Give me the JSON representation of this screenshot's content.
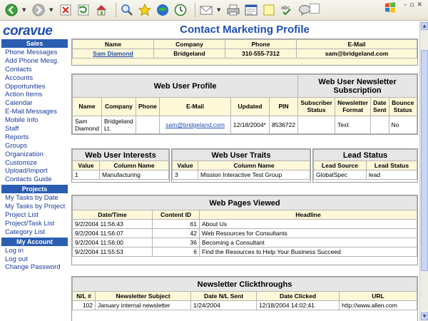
{
  "browser": {
    "icons": [
      "back-icon",
      "forward-icon",
      "stop-icon",
      "refresh-icon",
      "home-icon",
      "search-icon",
      "favorites-icon",
      "media-icon",
      "history-icon",
      "mail-icon",
      "print-icon",
      "edit-icon",
      "discuss-icon",
      "spellcheck-icon",
      "messenger-icon"
    ]
  },
  "brand": {
    "logo_text": "coravue"
  },
  "sidebar": {
    "sales_header": "Sales",
    "sales_items": [
      "Phone Messages",
      "Add Phone Mesg.",
      "Contacts",
      "Accounts",
      "Opportunities",
      "Action Items",
      "Calendar",
      "E-Mail Messages",
      "Mobile Info",
      "Staff",
      "Reports",
      "Groups",
      "Organization",
      "Customize",
      "Upload/Import",
      "Contacts Guide"
    ],
    "projects_header": "Projects",
    "projects_items": [
      "My Tasks by Date",
      "My Tasks by Project",
      "Project List",
      "Project/Task List",
      "Category List"
    ],
    "account_header": "My Account",
    "account_items": [
      "Log in",
      "Log out",
      "Change Password"
    ]
  },
  "page": {
    "title": "Contact Marketing Profile"
  },
  "contact": {
    "headers": [
      "Name",
      "Company",
      "Phone",
      "E-Mail"
    ],
    "name": "Sam Diamond",
    "company": "Bridgeland",
    "phone": "310-555-7312",
    "email": "sam@bridgeland.com"
  },
  "web_user_profile": {
    "title": "Web User Profile",
    "headers": [
      "Name",
      "Company",
      "Phone",
      "E-Mail",
      "Updated",
      "PIN"
    ],
    "name": "Sam Diamond",
    "company": "Bridgeland Lt.",
    "phone": "",
    "email": "sam@bridgeland.com",
    "updated": "12/18/2004*",
    "pin": "8536722"
  },
  "newsletter_subscription": {
    "title": "Web User Newsletter Subscription",
    "headers": [
      "Subscriber Status",
      "Newsletter Format",
      "Date Sent",
      "Bounce Status"
    ],
    "subscriber_status": "",
    "format": "Text",
    "date_sent": "",
    "bounce_status": "No"
  },
  "interests": {
    "title": "Web User Interests",
    "headers": [
      "Value",
      "Column Name"
    ],
    "rows": [
      [
        "1",
        "Manufacturing"
      ]
    ]
  },
  "traits": {
    "title": "Web User Traits",
    "headers": [
      "Value",
      "Column Name"
    ],
    "rows": [
      [
        "3",
        "Mission Interactive Test Group"
      ]
    ]
  },
  "lead_status": {
    "title": "Lead Status",
    "headers": [
      "Lead Source",
      "Lead Status"
    ],
    "rows": [
      [
        "GlobalSpec",
        "lead"
      ]
    ]
  },
  "pages_viewed": {
    "title": "Web Pages Viewed",
    "headers": [
      "Date/Time",
      "Content ID",
      "Headline"
    ],
    "rows": [
      [
        "9/2/2004 11:56:43",
        "61",
        "About Us"
      ],
      [
        "9/2/2004 11:56:07",
        "42",
        "Web Resources for Consultants"
      ],
      [
        "9/2/2004 11:56:00",
        "36",
        "Becoming a Consultant"
      ],
      [
        "9/2/2004 11:55:53",
        "6",
        "Find the Resources to Help Your Business Succeed"
      ]
    ]
  },
  "clickthroughs": {
    "title": "Newsletter Clickthroughs",
    "headers": [
      "N/L #",
      "Newsletter Subject",
      "Date N/L Sent",
      "Date Clicked",
      "URL"
    ],
    "rows": [
      [
        "102",
        "January internal newsletter",
        "1/24/2004",
        "12/18/2004 14:02:41",
        "http://www.allen.com"
      ]
    ]
  }
}
